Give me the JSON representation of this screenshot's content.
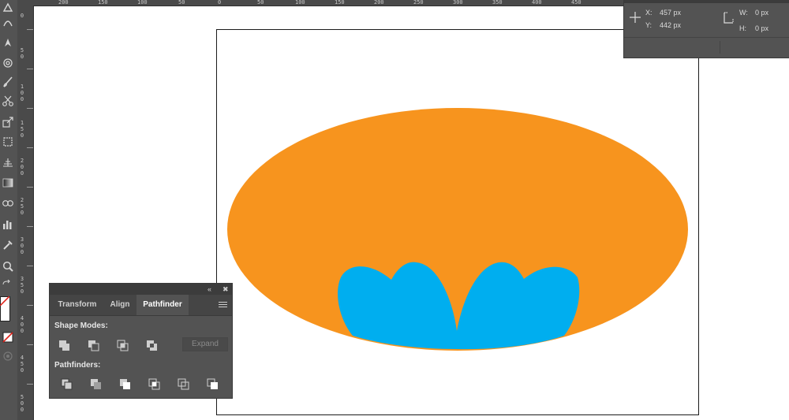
{
  "info": {
    "x_label": "X:",
    "x_value": "457 px",
    "y_label": "Y:",
    "y_value": "442 px",
    "w_label": "W:",
    "w_value": "0 px",
    "h_label": "H:",
    "h_value": "0 px"
  },
  "hruler": [
    "200",
    "150",
    "100",
    "50",
    "0",
    "50",
    "100",
    "150",
    "200",
    "250",
    "300",
    "350",
    "400",
    "450"
  ],
  "vruler": [
    "0",
    "5\n0",
    "1\n0\n0",
    "1\n5\n0",
    "2\n0\n0",
    "2\n5\n0",
    "3\n0\n0",
    "3\n5\n0",
    "4\n0\n0",
    "4\n5\n0",
    "5\n0\n0"
  ],
  "pathfinder_panel": {
    "tabs": [
      "Transform",
      "Align",
      "Pathfinder"
    ],
    "active_tab": "Pathfinder",
    "shape_modes_label": "Shape Modes:",
    "pathfinders_label": "Pathfinders:",
    "expand_label": "Expand"
  },
  "colors": {
    "ellipse": "#F7941E",
    "shape": "#00AEEF",
    "ui_bg": "#535353"
  },
  "icons": {
    "collapse": "double-chevron-left-icon",
    "close": "close-icon",
    "menu": "panel-menu-icon"
  }
}
